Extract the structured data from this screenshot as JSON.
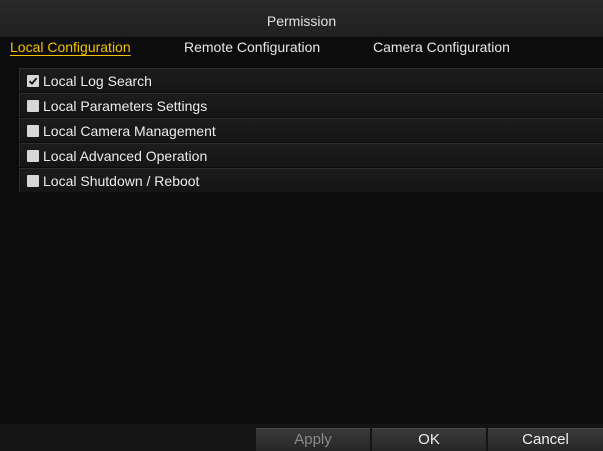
{
  "window": {
    "title": "Permission"
  },
  "tabs": [
    {
      "label": "Local Configuration",
      "active": true
    },
    {
      "label": "Remote Configuration",
      "active": false
    },
    {
      "label": "Camera Configuration",
      "active": false
    }
  ],
  "permissions": [
    {
      "label": "Local Log Search",
      "checked": true
    },
    {
      "label": "Local Parameters Settings",
      "checked": false
    },
    {
      "label": "Local Camera Management",
      "checked": false
    },
    {
      "label": "Local Advanced Operation",
      "checked": false
    },
    {
      "label": "Local Shutdown / Reboot",
      "checked": false
    }
  ],
  "footer": {
    "apply_label": "Apply",
    "ok_label": "OK",
    "cancel_label": "Cancel",
    "apply_disabled": true
  },
  "colors": {
    "accent": "#f2c200",
    "background": "#0c0c0c"
  },
  "icons": {
    "checkbox_checked": "check-icon"
  }
}
